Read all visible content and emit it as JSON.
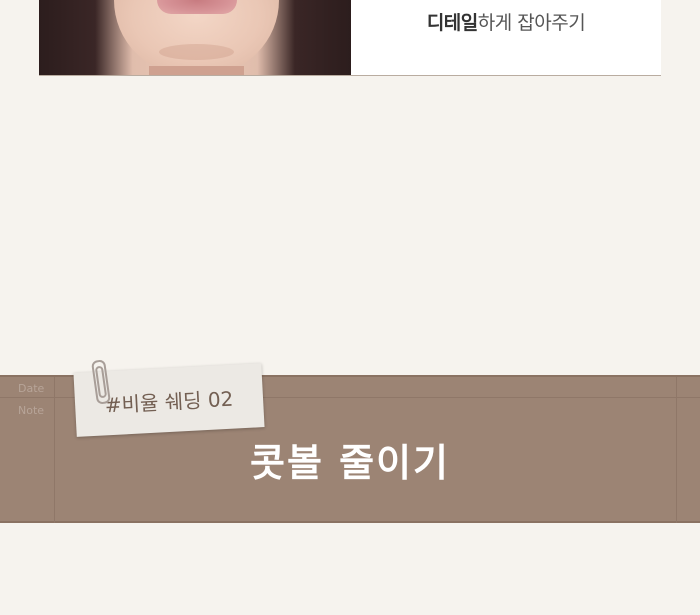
{
  "top_card": {
    "caption_strong": "디테일",
    "caption_rest": "하게 잡아주기"
  },
  "notebook": {
    "date_label": "Date",
    "note_label": "Note",
    "tag": "#비율 쉐딩 02",
    "title": "콧볼 줄이기"
  }
}
